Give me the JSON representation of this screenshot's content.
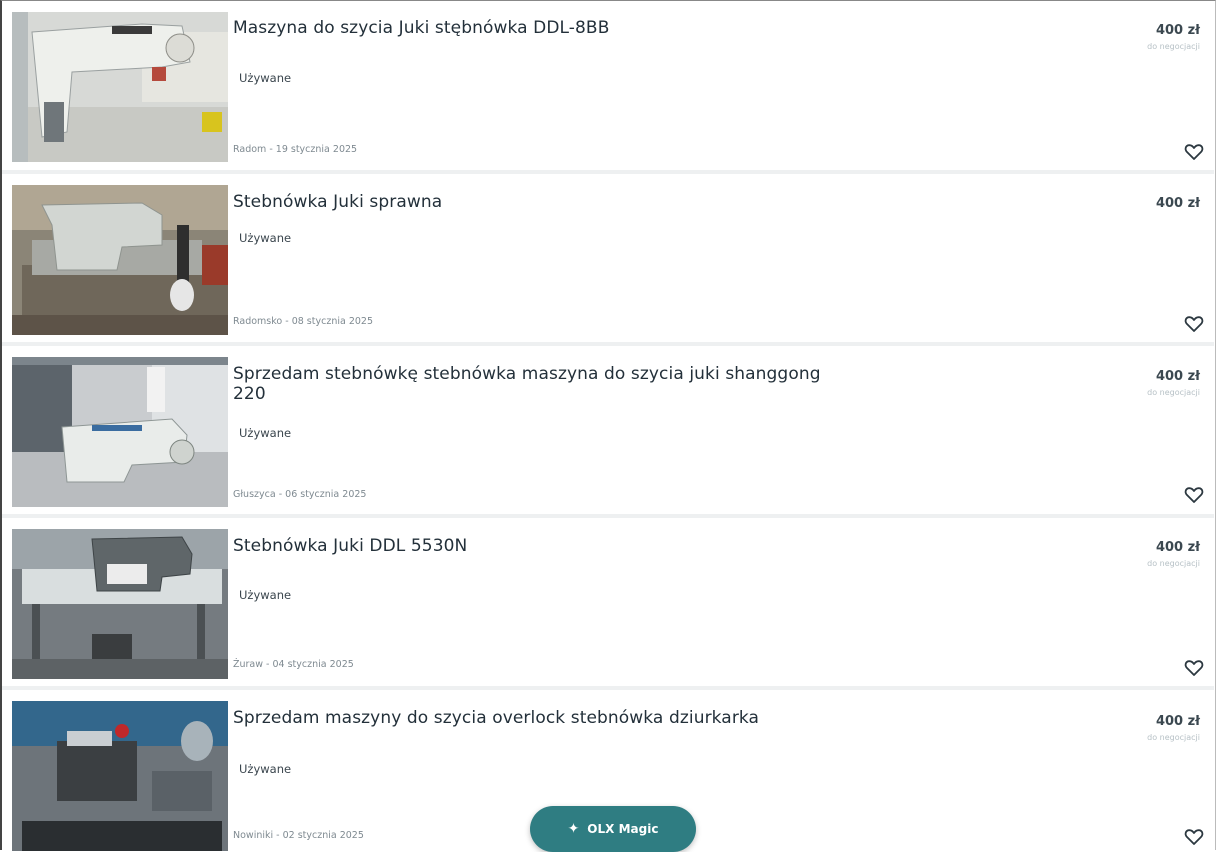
{
  "listings": [
    {
      "title": "Maszyna do szycia Juki stębnówka DDL-8BB",
      "condition": "Używane",
      "location_date": "Radom - 19 stycznia 2025",
      "price": "400 zł",
      "negotiable": "do negocjacji"
    },
    {
      "title": "Stebnówka Juki sprawna",
      "condition": "Używane",
      "location_date": "Radomsko - 08 stycznia 2025",
      "price": "400 zł",
      "negotiable": ""
    },
    {
      "title": "Sprzedam stebnówkę stebnówka maszyna do szycia juki shanggong 220",
      "condition": "Używane",
      "location_date": "Głuszyca - 06 stycznia 2025",
      "price": "400 zł",
      "negotiable": "do negocjacji"
    },
    {
      "title": "Stebnówka Juki DDL 5530N",
      "condition": "Używane",
      "location_date": "Żuraw - 04 stycznia 2025",
      "price": "400 zł",
      "negotiable": "do negocjacji"
    },
    {
      "title": "Sprzedam maszyny do szycia overlock stebnówka dziurkarka",
      "condition": "Używane",
      "location_date": "Nowiniki - 02 stycznia 2025",
      "price": "400 zł",
      "negotiable": "do negocjacji"
    }
  ],
  "magic_button": {
    "icon": "sparkle-icon",
    "label": "OLX Magic"
  },
  "icons": {
    "favorite": "heart-outline-icon"
  },
  "colors": {
    "magic_button_bg": "#2f7d82",
    "price_text": "#3b4850"
  }
}
